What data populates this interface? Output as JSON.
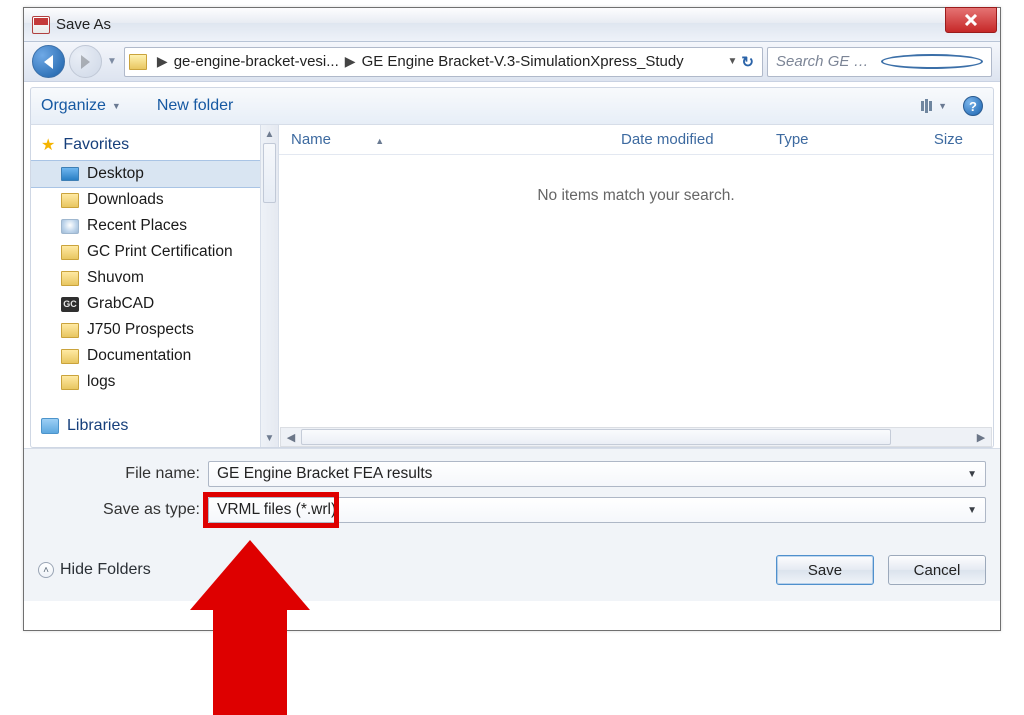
{
  "window": {
    "title": "Save As"
  },
  "breadcrumb": {
    "seg1": "ge-engine-bracket-vesi...",
    "seg2": "GE Engine Bracket-V.3-SimulationXpress_Study"
  },
  "search": {
    "placeholder": "Search GE Engine Brack..."
  },
  "toolbar": {
    "organize": "Organize",
    "newfolder": "New folder"
  },
  "favorites": {
    "title": "Favorites",
    "items": [
      {
        "label": "Desktop"
      },
      {
        "label": "Downloads"
      },
      {
        "label": "Recent Places"
      },
      {
        "label": "GC Print Certification"
      },
      {
        "label": "Shuvom"
      },
      {
        "label": "GrabCAD"
      },
      {
        "label": "J750 Prospects"
      },
      {
        "label": "Documentation"
      },
      {
        "label": "logs"
      }
    ]
  },
  "libraries": {
    "title": "Libraries"
  },
  "columns": {
    "name": "Name",
    "date": "Date modified",
    "type": "Type",
    "size": "Size"
  },
  "list": {
    "empty_message": "No items match your search."
  },
  "form": {
    "filename_label": "File name:",
    "filename_value": "GE Engine Bracket FEA results",
    "saveastype_label": "Save as type:",
    "saveastype_value": "VRML files (*.wrl)"
  },
  "footer": {
    "hide_folders": "Hide Folders",
    "save": "Save",
    "cancel": "Cancel"
  }
}
